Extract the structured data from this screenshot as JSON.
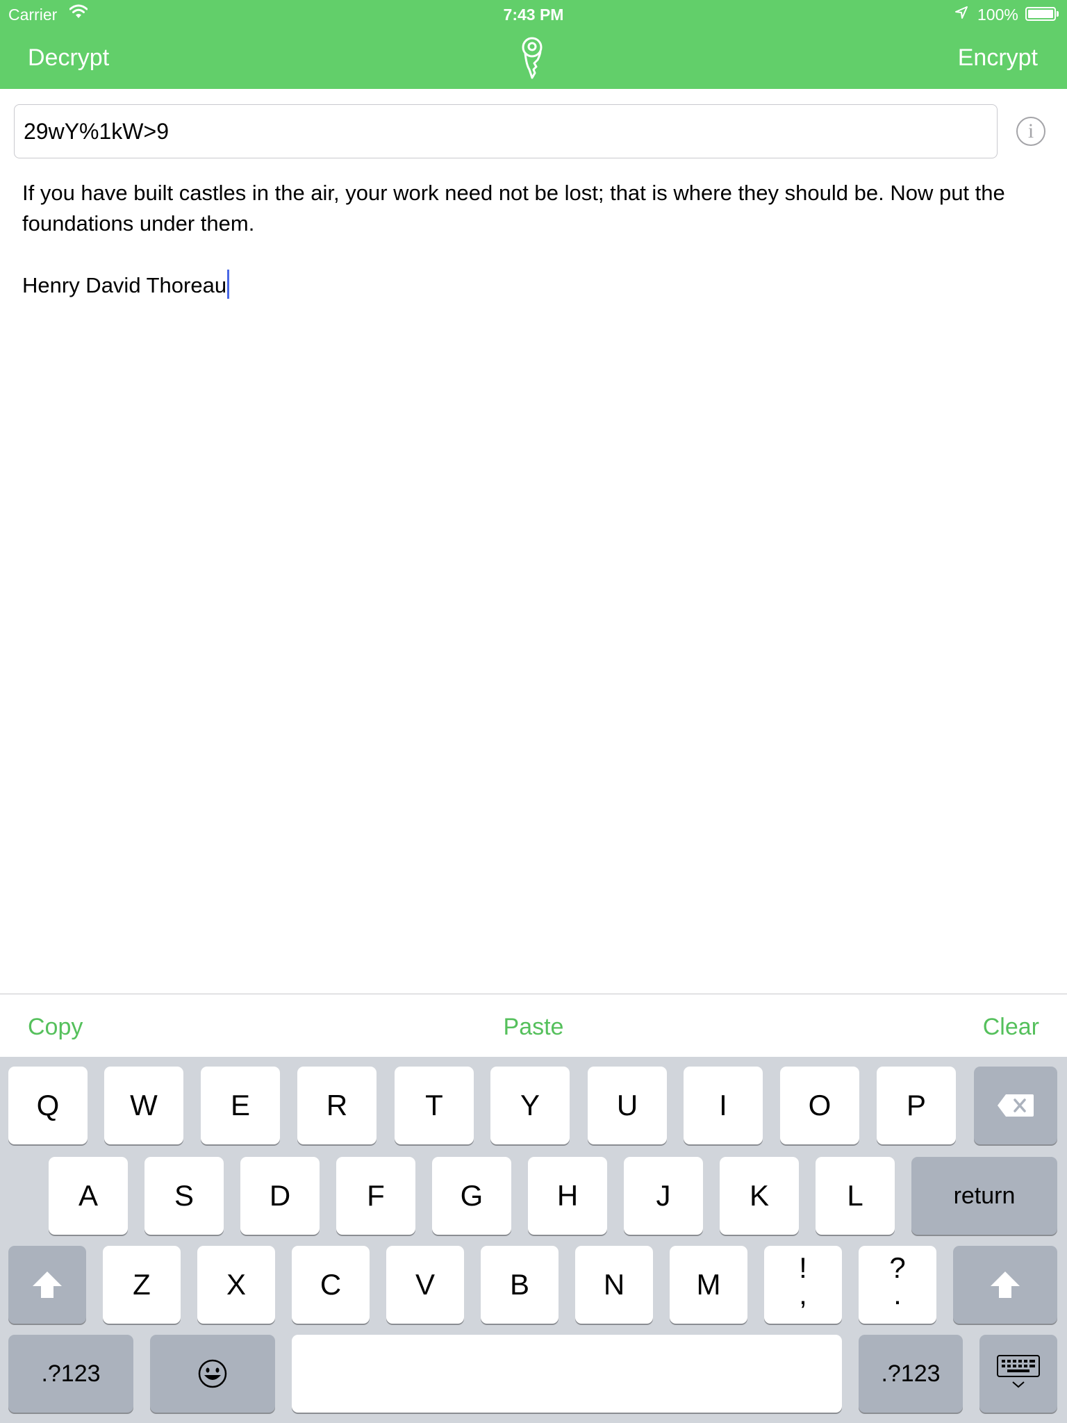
{
  "status_bar": {
    "carrier": "Carrier",
    "time": "7:43 PM",
    "battery": "100%"
  },
  "nav": {
    "left": "Decrypt",
    "right": "Encrypt",
    "logo_icon": "key-icon"
  },
  "key_field": {
    "value": "29wY%1kW>9"
  },
  "info_label": "i",
  "content": {
    "text": "If you have built castles in the air, your work need not be lost; that is where they should be. Now put the foundations under them.",
    "signature": "Henry David Thoreau"
  },
  "accessory": {
    "copy": "Copy",
    "paste": "Paste",
    "clear": "Clear"
  },
  "keyboard": {
    "row1": [
      "Q",
      "W",
      "E",
      "R",
      "T",
      "Y",
      "U",
      "I",
      "O",
      "P"
    ],
    "row2": [
      "A",
      "S",
      "D",
      "F",
      "G",
      "H",
      "J",
      "K",
      "L"
    ],
    "row3": [
      "Z",
      "X",
      "C",
      "V",
      "B",
      "N",
      "M"
    ],
    "punct1": {
      "top": "!",
      "bottom": ","
    },
    "punct2": {
      "top": "?",
      "bottom": "."
    },
    "return": "return",
    "numbers": ".?123"
  },
  "colors": {
    "accent": "#62cf6a",
    "accessory_text": "#55c05c",
    "keyboard_bg": "#d1d5db",
    "caret": "#4a68e5"
  }
}
